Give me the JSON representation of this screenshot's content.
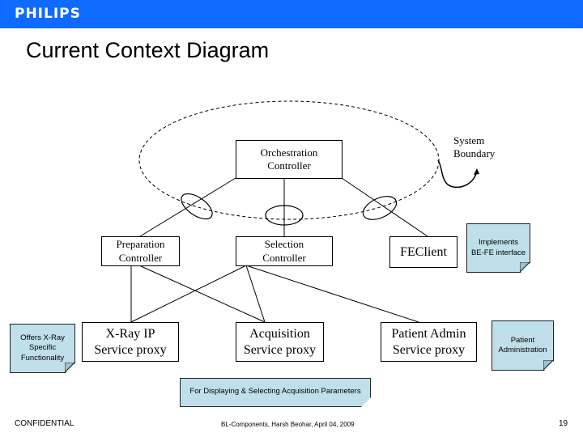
{
  "header": {
    "brand": "PHILIPS",
    "brand_color": "#0f6bff"
  },
  "slide": {
    "title": "Current Context Diagram"
  },
  "diagram": {
    "boundary_label_line1": "System",
    "boundary_label_line2": "Boundary",
    "nodes": {
      "orchestration": {
        "line1": "Orchestration",
        "line2": "Controller"
      },
      "preparation": {
        "line1": "Preparation",
        "line2": "Controller"
      },
      "selection": {
        "line1": "Selection",
        "line2": "Controller"
      },
      "feclient": {
        "line1": "FEClient"
      },
      "xray": {
        "line1": "X-Ray IP",
        "line2": "Service proxy"
      },
      "acquisition": {
        "line1": "Acquisition",
        "line2": "Service proxy"
      },
      "patient_admin": {
        "line1": "Patient Admin",
        "line2": "Service proxy"
      }
    },
    "notes": {
      "implements": {
        "line1": "Implements",
        "line2": "BE-FE interface"
      },
      "offers": {
        "line1": "Offers X-Ray",
        "line2": "Specific",
        "line3": "Functionality"
      },
      "patient_administration": {
        "line1": "Patient",
        "line2": "Administration"
      },
      "acquisition_params": {
        "line1": "For Displaying & Selecting Acquisition Parameters"
      }
    },
    "note_color": "#bfe0ea"
  },
  "footer": {
    "confidential": "CONFIDENTIAL",
    "center": "BL-Components, Harsh Beohar, April 04, 2009",
    "page_number": "19"
  }
}
